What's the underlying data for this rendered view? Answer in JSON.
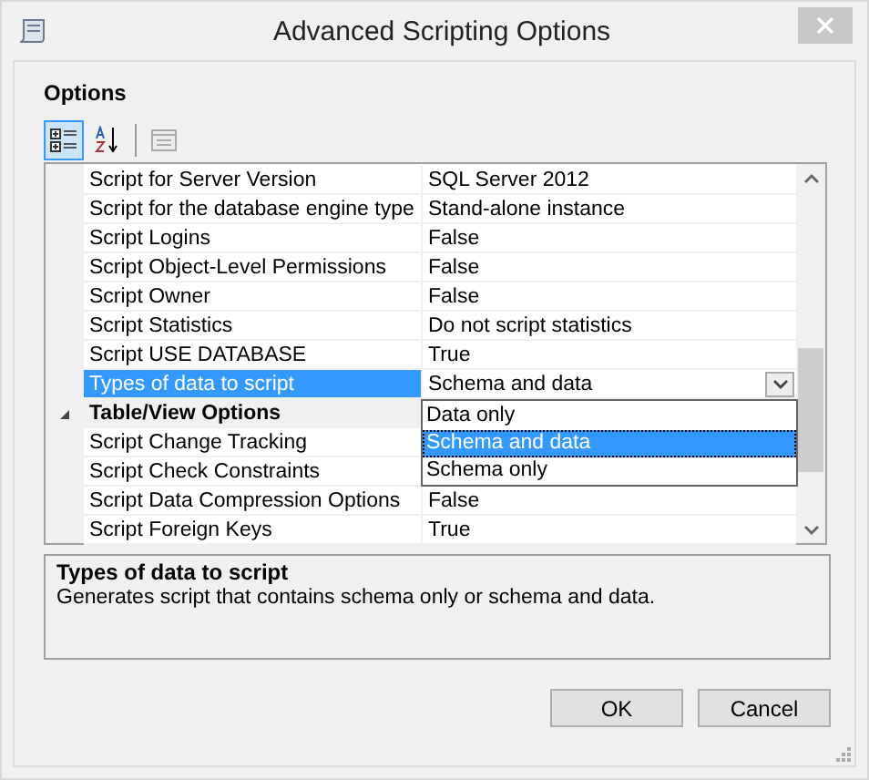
{
  "window": {
    "title": "Advanced Scripting Options"
  },
  "section_label": "Options",
  "toolbar": [
    {
      "kind": "categorized",
      "selected": true
    },
    {
      "kind": "alphabetical",
      "selected": false
    },
    {
      "kind": "pages",
      "selected": false
    }
  ],
  "grid": {
    "rows": [
      {
        "kind": "property",
        "name": "Script for Server Version",
        "value": "SQL Server 2012",
        "selected": false
      },
      {
        "kind": "property",
        "name": "Script for the database engine type",
        "value": "Stand-alone instance",
        "selected": false
      },
      {
        "kind": "property",
        "name": "Script Logins",
        "value": "False",
        "selected": false
      },
      {
        "kind": "property",
        "name": "Script Object-Level Permissions",
        "value": "False",
        "selected": false
      },
      {
        "kind": "property",
        "name": "Script Owner",
        "value": "False",
        "selected": false
      },
      {
        "kind": "property",
        "name": "Script Statistics",
        "value": "Do not script statistics",
        "selected": false
      },
      {
        "kind": "property",
        "name": "Script USE DATABASE",
        "value": "True",
        "selected": false
      },
      {
        "kind": "property",
        "name": "Types of data to script",
        "value": "Schema and data",
        "selected": true
      },
      {
        "kind": "category",
        "name": "Table/View Options",
        "expanded": true
      },
      {
        "kind": "property",
        "name": "Script Change Tracking",
        "selected": false
      },
      {
        "kind": "property",
        "name": "Script Check Constraints",
        "selected": false
      },
      {
        "kind": "property",
        "name": "Script Data Compression Options",
        "value": "False",
        "selected": false
      },
      {
        "kind": "property",
        "name": "Script Foreign Keys",
        "value": "True",
        "selected": false
      }
    ],
    "dropdown": {
      "options": [
        {
          "label": "Data only",
          "selected": false
        },
        {
          "label": "Schema and data",
          "selected": true
        },
        {
          "label": "Schema only",
          "selected": false
        }
      ]
    }
  },
  "description": {
    "title": "Types of data to script",
    "text": "Generates script that contains schema only or schema and data."
  },
  "buttons": [
    "OK",
    "Cancel"
  ]
}
